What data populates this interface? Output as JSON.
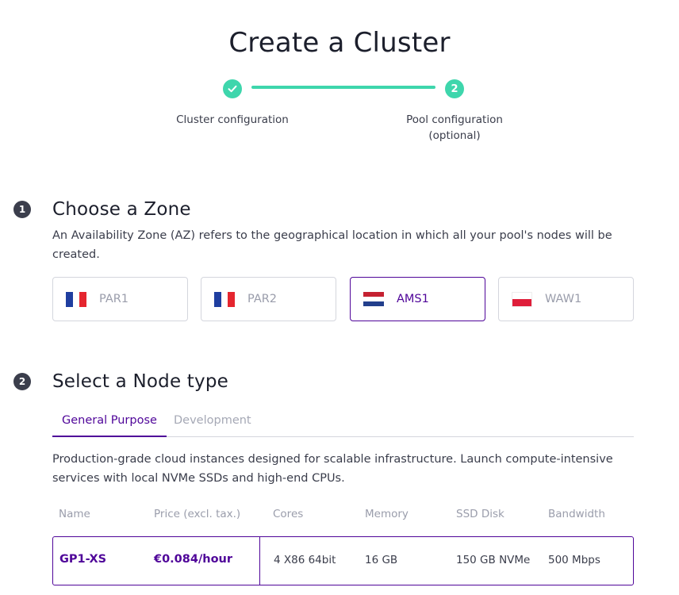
{
  "page": {
    "title": "Create a Cluster"
  },
  "stepper": {
    "steps": [
      {
        "label": "Cluster configuration",
        "status": "completed",
        "icon": "check-icon"
      },
      {
        "number": "2",
        "label_line1": "Pool configuration",
        "label_line2": "(optional)",
        "status": "active"
      }
    ],
    "accent_color": "#3ed6ac"
  },
  "zone_section": {
    "number": "1",
    "title": "Choose a Zone",
    "description": "An Availability Zone (AZ) refers to the geographical location in which all your pool's nodes will be created.",
    "zones": [
      {
        "code": "PAR1",
        "flag": "france-flag",
        "selected": false
      },
      {
        "code": "PAR2",
        "flag": "france-flag",
        "selected": false
      },
      {
        "code": "AMS1",
        "flag": "netherlands-flag",
        "selected": true
      },
      {
        "code": "WAW1",
        "flag": "poland-flag",
        "selected": false
      }
    ]
  },
  "node_section": {
    "number": "2",
    "title": "Select a Node type",
    "tabs": [
      {
        "label": "General Purpose",
        "active": true
      },
      {
        "label": "Development",
        "active": false
      }
    ],
    "description": "Production-grade cloud instances designed for scalable infrastructure. Launch compute-intensive services with local NVMe SSDs and high-end CPUs.",
    "columns": [
      "Name",
      "Price (excl. tax.)",
      "Cores",
      "Memory",
      "SSD Disk",
      "Bandwidth"
    ],
    "rows": [
      {
        "name": "GP1-XS",
        "price": "€0.084/hour",
        "cores": "4 X86 64bit",
        "memory": "16 GB",
        "disk": "150 GB NVMe",
        "bandwidth": "500 Mbps",
        "selected": true
      }
    ]
  },
  "colors": {
    "primary": "#4f0599",
    "success": "#3ed6ac",
    "text": "#3a3d4b",
    "muted": "#9a9dab",
    "border": "#d4d6dd"
  }
}
